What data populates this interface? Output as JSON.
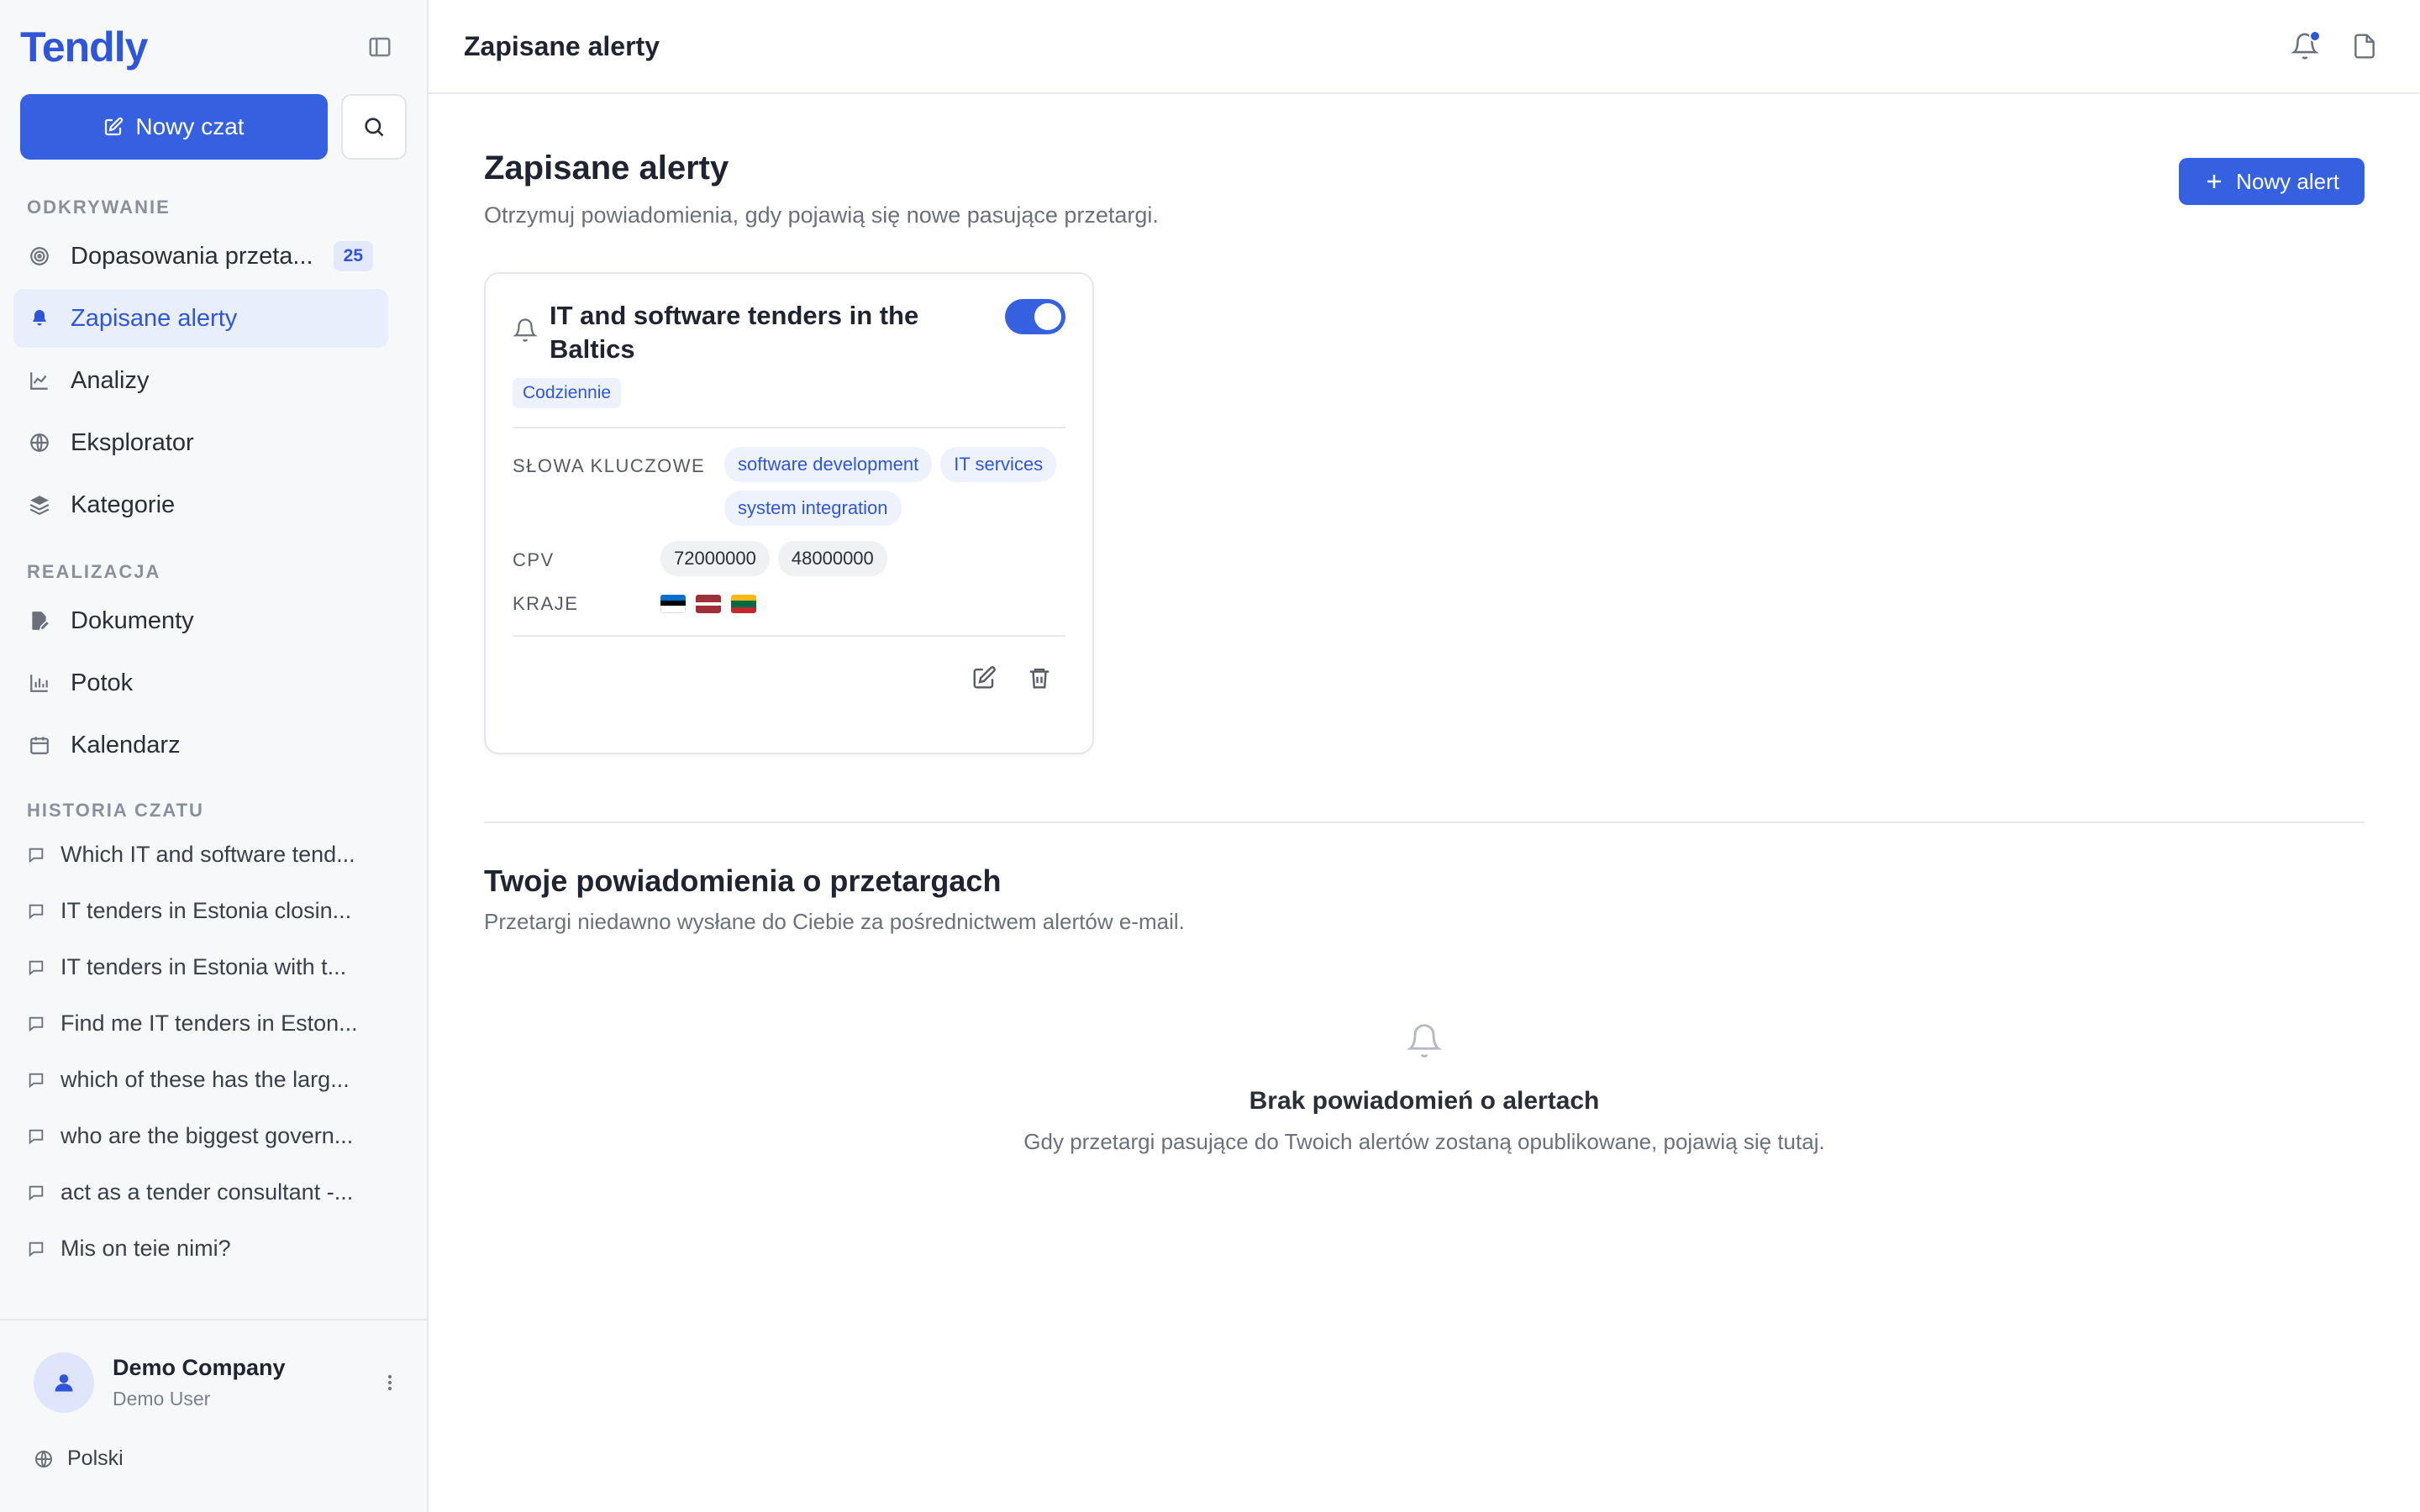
{
  "app": {
    "logo": "Tendly"
  },
  "sidebar": {
    "new_chat_label": "Nowy czat",
    "sections": {
      "discover": "ODKRYWANIE",
      "execution": "REALIZACJA",
      "history": "HISTORIA CZATU"
    },
    "discover_items": [
      {
        "label": "Dopasowania przeta...",
        "badge": "25",
        "icon": "target-icon"
      },
      {
        "label": "Zapisane alerty",
        "icon": "bell-icon",
        "active": true
      },
      {
        "label": "Analizy",
        "icon": "chart-line-icon"
      },
      {
        "label": "Eksplorator",
        "icon": "globe-icon"
      },
      {
        "label": "Kategorie",
        "icon": "layers-icon"
      }
    ],
    "execution_items": [
      {
        "label": "Dokumenty",
        "icon": "document-edit-icon"
      },
      {
        "label": "Potok",
        "icon": "bar-chart-icon"
      },
      {
        "label": "Kalendarz",
        "icon": "calendar-icon"
      }
    ],
    "history": [
      "Which IT and software tend...",
      "IT tenders in Estonia closin...",
      "IT tenders in Estonia with t...",
      "Find me IT tenders in Eston...",
      "which of these has the larg...",
      "who are the biggest govern...",
      "act as a tender consultant -...",
      "Mis on teie nimi?"
    ],
    "user": {
      "company": "Demo Company",
      "name": "Demo User"
    },
    "language": "Polski"
  },
  "topbar": {
    "title": "Zapisane alerty"
  },
  "page": {
    "title": "Zapisane alerty",
    "subtitle": "Otrzymuj powiadomienia, gdy pojawią się nowe pasujące przetargi.",
    "new_alert_label": "Nowy alert"
  },
  "alert_card": {
    "title": "IT and software tenders in the Baltics",
    "frequency": "Codziennie",
    "enabled": true,
    "keywords_label": "SŁOWA KLUCZOWE",
    "keywords": [
      "software development",
      "IT services",
      "system integration"
    ],
    "cpv_label": "CPV",
    "cpv": [
      "72000000",
      "48000000"
    ],
    "countries_label": "KRAJE",
    "countries": [
      {
        "code": "EE",
        "colors": [
          "#0072ce",
          "#000000",
          "#ffffff"
        ]
      },
      {
        "code": "LV",
        "colors": [
          "#9e3039",
          "#ffffff",
          "#9e3039"
        ]
      },
      {
        "code": "LT",
        "colors": [
          "#fdb913",
          "#006a44",
          "#c1272d"
        ]
      }
    ]
  },
  "notifications": {
    "title": "Twoje powiadomienia o przetargach",
    "subtitle": "Przetargi niedawno wysłane do Ciebie za pośrednictwem alertów e-mail.",
    "empty_title": "Brak powiadomień o alertach",
    "empty_subtitle": "Gdy przetargi pasujące do Twoich alertów zostaną opublikowane, pojawią się tutaj."
  },
  "colors": {
    "accent": "#3560e0",
    "sidebar_bg": "#f7f8fa"
  }
}
